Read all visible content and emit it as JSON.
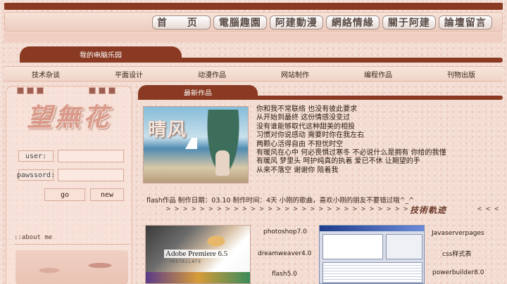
{
  "top_nav": [
    {
      "label": "首  页"
    },
    {
      "label": "電腦趣園"
    },
    {
      "label": "阿建動漫"
    },
    {
      "label": "網絡情緣"
    },
    {
      "label": "關于阿建"
    },
    {
      "label": "論壇留言"
    }
  ],
  "site": {
    "name": "我的电脑乐园",
    "logo_text": "望無花"
  },
  "categories": [
    "技术杂谈",
    "平面设计",
    "动漫作品",
    "网站制作",
    "编程作品",
    "刊物出版"
  ],
  "login": {
    "user_label": "user:",
    "password_label": "pawssord:",
    "go_label": "go",
    "new_label": "new"
  },
  "about": {
    "heading": "::about me"
  },
  "latest": {
    "tab_label": "最新作品",
    "image_title": "晴风",
    "poem": [
      "你和我不常联络  也没有彼此要求",
      "从开始到最终  这份情感没变过",
      "没有谁能够取代这种甜美的相投",
      "习惯对你说感动  需要时你在我左右",
      "两颗心活得自由  不担忧时空",
      "有暖风在心中  何必畏惧过寒冬  不必说什么是拥有  你给的我懂",
      "有暖风  梦里头  呵护纯真的执着  爱已不休  让期望的手",
      "从来不落空  谢谢你  陪着我"
    ],
    "info": "flash作品  制作日期：03.10  制作时间：4天  小刚的歌曲，喜欢小刚的朋友不要错过哦^_^"
  },
  "skills": {
    "arrows": "> > > > > > > > > > > > > > > > > > > > > > > > > > > > >",
    "arrows_tail": "< < < <",
    "label": "技術軌迹",
    "items_left": [
      "photoshop7.0",
      "dreamweaver4.0",
      "flash5.0"
    ],
    "items_right": [
      "Javaserverpages",
      "css样式表",
      "powerbuilder8.0"
    ],
    "thumb1_brand": "Adobe Premiere 6.5",
    "thumb1_sub": "INSTALLATE"
  }
}
